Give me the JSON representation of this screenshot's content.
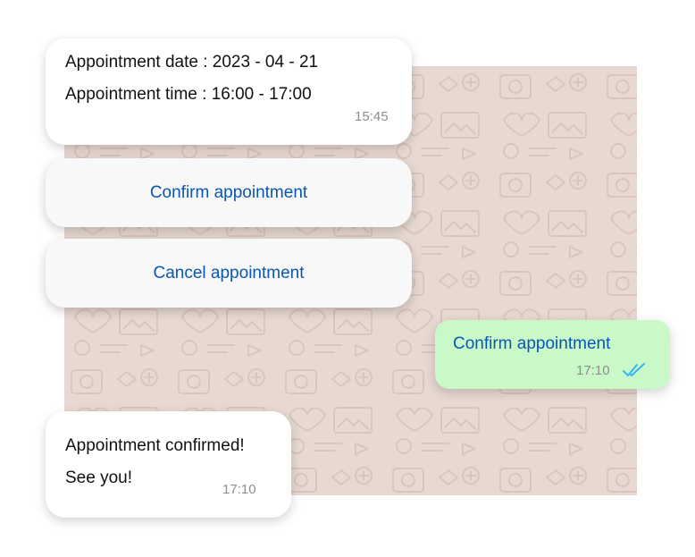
{
  "appointment_message": {
    "date_line": "Appointment date : 2023 - 04 - 21",
    "time_line": "Appointment time : 16:00 - 17:00",
    "timestamp": "15:45"
  },
  "actions": {
    "confirm_label": "Confirm appointment",
    "cancel_label": "Cancel appointment"
  },
  "sent_message": {
    "text": "Confirm appointment",
    "timestamp": "17:10",
    "status_icon": "double-check-icon",
    "status_color": "#34b7f1"
  },
  "confirmation_message": {
    "line1": "Appointment confirmed!",
    "line2": "See you!",
    "timestamp": "17:10"
  },
  "colors": {
    "wallpaper": "#e7d9d1",
    "sent_bubble": "#c9f9c9",
    "link_blue": "#0a56b3"
  }
}
